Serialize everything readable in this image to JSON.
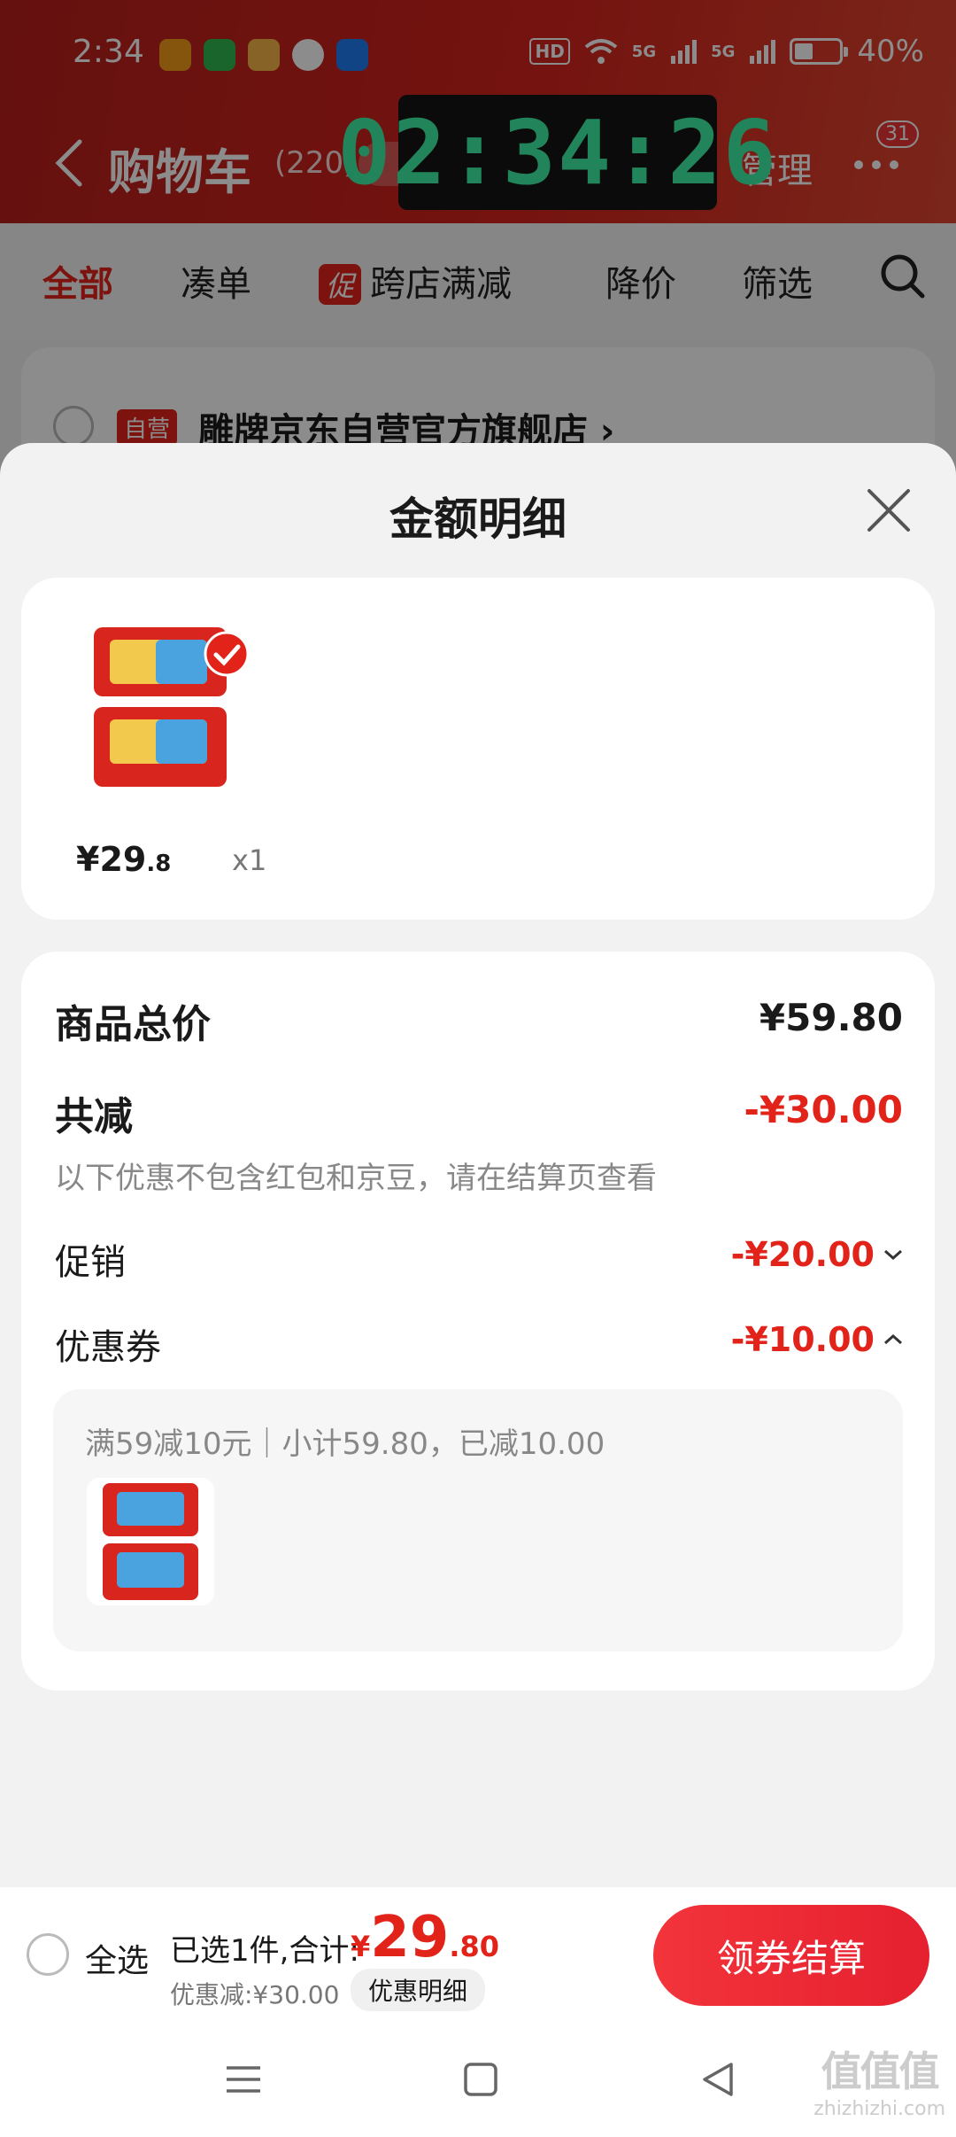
{
  "status_bar": {
    "time": "2:34",
    "network": "5G",
    "battery": "40%",
    "hd_label": "HD"
  },
  "nav": {
    "title": "购物车",
    "count": "(220)",
    "timer": "02:34:26",
    "manage": "管理",
    "more_badge": "31"
  },
  "tabs": {
    "all": "全部",
    "bundle": "凑单",
    "promo_chip": "促",
    "cross_store": "跨店满减",
    "price_drop": "降价",
    "filter": "筛选"
  },
  "store": {
    "badge": "自营",
    "name": "雕牌京东自营官方旗舰店 ›"
  },
  "sheet": {
    "title": "金额明细",
    "item": {
      "price_symbol": "¥",
      "price_int": "29",
      "price_dec": ".8",
      "qty": "x1"
    },
    "goods_total_label": "商品总价",
    "goods_total_value": "¥59.80",
    "total_discount_label": "共减",
    "total_discount_value": "-¥30.00",
    "hint": "以下优惠不包含红包和京豆，请在结算页查看",
    "promotion_label": "促销",
    "promotion_value": "-¥20.00",
    "coupon_label": "优惠券",
    "coupon_value": "-¥10.00",
    "coupon_detail": "满59减10元｜小计59.80，已减10.00"
  },
  "checkout": {
    "select_all": "全选",
    "selected": "已选1件,合计:",
    "currency": "¥",
    "total_int": "29",
    "total_dec": ".80",
    "discount": "优惠减:¥30.00",
    "detail_button": "优惠明细",
    "pay_button": "领券结算"
  },
  "watermark": {
    "big": "值值值",
    "small": "zhizhizhi.com"
  },
  "colors": {
    "accent": "#e2231a",
    "timer": "#3ef0a6"
  }
}
